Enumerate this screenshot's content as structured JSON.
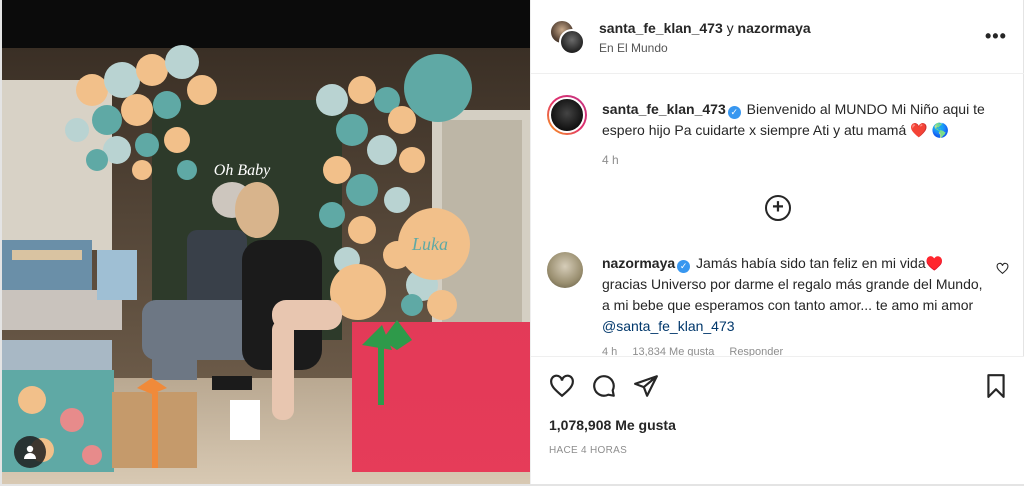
{
  "header": {
    "user1": "santa_fe_klan_473",
    "connector": "y",
    "user2": "nazormaya",
    "location": "En El Mundo",
    "more_label": "•••"
  },
  "caption": {
    "username": "santa_fe_klan_473",
    "text": "Bienvenido al MUNDO Mi Niño aqui te espero hijo Pa cuidarte x siempre Ati y atu mamá ❤️ 🌎",
    "time": "4 h"
  },
  "load_more": {
    "label": "+"
  },
  "comment": {
    "username": "nazormaya",
    "text": "Jamás había sido tan feliz en mi vida♥️ gracias Universo por darme el regalo más grande del Mundo, a mi bebe que esperamos con tanto amor... te amo mi amor ",
    "mention": "@santa_fe_klan_473",
    "time": "4 h",
    "likes": "13,834 Me gusta",
    "reply": "Responder"
  },
  "post": {
    "likes_count": "1,078,908",
    "likes_label": "Me gusta",
    "time_ago": "HACE 4 HORAS"
  },
  "photo": {
    "sign_text": "Oh Baby",
    "balloon_text": "Luka"
  },
  "colors": {
    "verified": "#3897f0",
    "mention": "#00376b",
    "balloon_teal": "#5fa9a5",
    "balloon_peach": "#f2c08a"
  }
}
